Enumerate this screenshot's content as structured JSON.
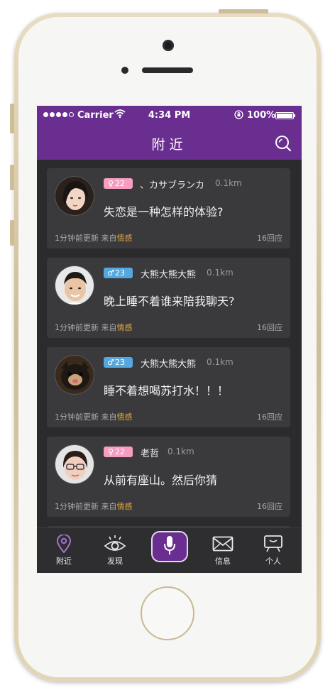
{
  "status": {
    "carrier": "Carrier",
    "time": "4:34 PM",
    "battery": "100%"
  },
  "header": {
    "title": "附近"
  },
  "posts": [
    {
      "badge_gender": "female",
      "badge_age": "22",
      "name": "、カサブランカ",
      "distance": "0.1km",
      "text": "失恋是一种怎样的体验?",
      "updated": "1分钟前更新",
      "from_label": "来自",
      "category": "情感",
      "replies": "16回应"
    },
    {
      "badge_gender": "male",
      "badge_age": "23",
      "name": "大熊大熊大熊",
      "distance": "0.1km",
      "text": "晚上睡不着谁来陪我聊天?",
      "updated": "1分钟前更新",
      "from_label": "来自",
      "category": "情感",
      "replies": "16回应"
    },
    {
      "badge_gender": "male",
      "badge_age": "23",
      "name": "大熊大熊大熊",
      "distance": "0.1km",
      "text": "睡不着想喝苏打水！！！",
      "updated": "1分钟前更新",
      "from_label": "来自",
      "category": "情感",
      "replies": "16回应"
    },
    {
      "badge_gender": "female",
      "badge_age": "22",
      "name": "老哲",
      "distance": "0.1km",
      "text": "从前有座山。然后你猜",
      "updated": "1分钟前更新",
      "from_label": "来自",
      "category": "情感",
      "replies": "16回应"
    }
  ],
  "tabs": [
    {
      "label": "附近",
      "icon": "location-pin-icon"
    },
    {
      "label": "发现",
      "icon": "eye-icon"
    },
    {
      "label": "",
      "icon": "microphone-icon"
    },
    {
      "label": "信息",
      "icon": "envelope-icon"
    },
    {
      "label": "个人",
      "icon": "person-icon"
    }
  ],
  "colors": {
    "accent": "#6a2e90",
    "female_badge": "#f59ec2",
    "male_badge": "#55a8df",
    "category": "#e2a23b"
  }
}
